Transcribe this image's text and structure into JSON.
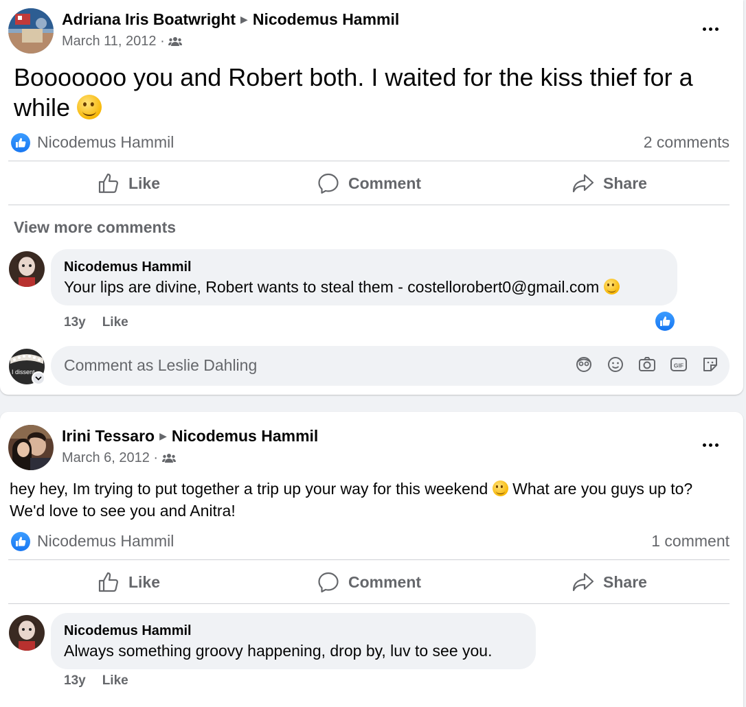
{
  "posts": [
    {
      "author": "Adriana Iris Boatwright",
      "recipient": "Nicodemus Hammil",
      "date": "March 11, 2012",
      "date_suffix": "·",
      "text": "Booooooo you and Robert both. I waited for the kiss thief for a while",
      "reaction_name": "Nicodemus Hammil",
      "comment_count": "2 comments",
      "view_more": "View more comments",
      "comments": [
        {
          "author": "Nicodemus Hammil",
          "text": "Your lips are divine, Robert wants to steal them - costellorobert0@gmail.com",
          "age": "13y",
          "like": "Like"
        }
      ],
      "reply_placeholder": "Comment as Leslie Dahling",
      "reply_avatar_text": "I dissent"
    },
    {
      "author": "Irini Tessaro",
      "recipient": "Nicodemus Hammil",
      "date": "March 6, 2012",
      "date_suffix": "·",
      "text_part1": "hey hey, Im trying to put together a trip up your way for this weekend",
      "text_part2": "What are you guys up to? We'd love to see you and Anitra!",
      "reaction_name": "Nicodemus Hammil",
      "comment_count": "1 comment",
      "comments": [
        {
          "author": "Nicodemus Hammil",
          "text": "Always something groovy happening, drop by, luv to see you.",
          "age": "13y",
          "like": "Like"
        }
      ]
    }
  ],
  "actions": {
    "like": "Like",
    "comment": "Comment",
    "share": "Share"
  },
  "colors": {
    "accent": "#1877f2",
    "secondary_text": "#65676b",
    "bubble": "#f0f2f5",
    "divider": "#ced0d4"
  },
  "icons": [
    "audience-friends-icon",
    "more-options-icon",
    "like-reaction-icon",
    "thumbs-up-icon",
    "comment-icon",
    "share-icon",
    "avatar-sticker-icon",
    "emoji-icon",
    "camera-icon",
    "gif-icon",
    "sticker-icon",
    "chevron-down-icon"
  ]
}
